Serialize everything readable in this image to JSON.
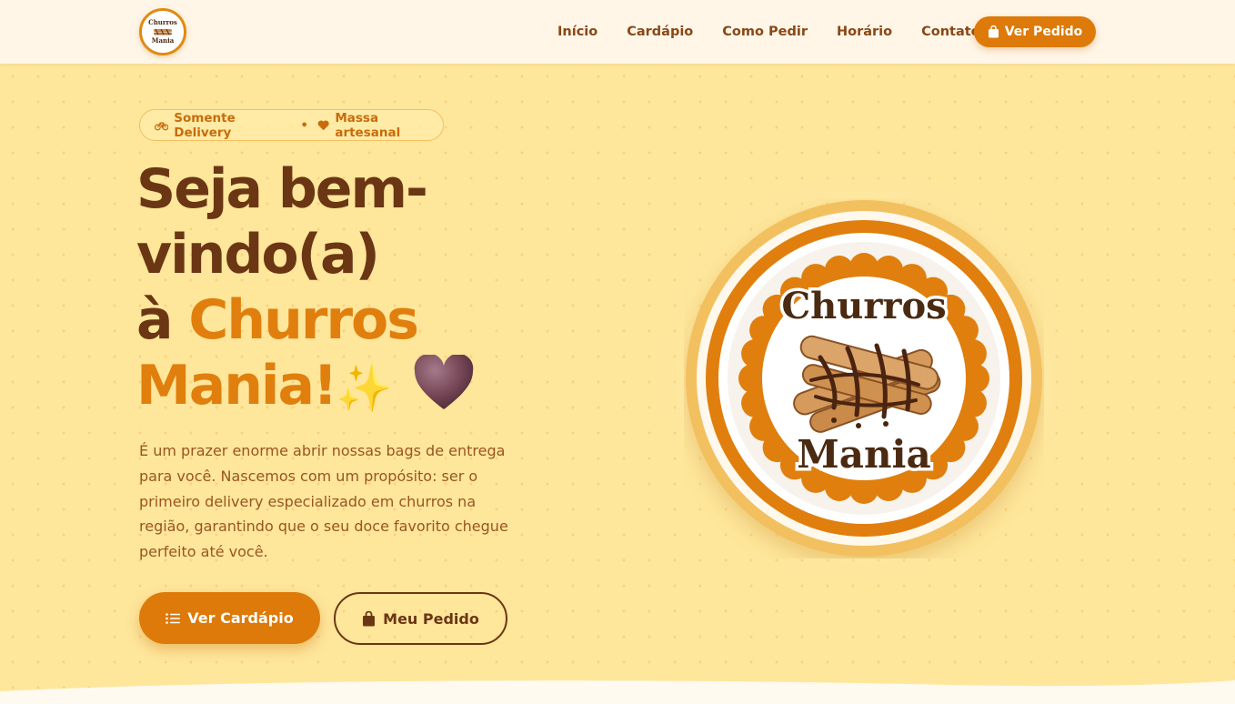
{
  "nav": {
    "logo_top": "Churros",
    "logo_bottom": "Mania",
    "links": [
      "Início",
      "Cardápio",
      "Como Pedir",
      "Horário",
      "Contato"
    ],
    "order_button": "Ver Pedido"
  },
  "hero": {
    "badge_left": "Somente Delivery",
    "badge_separator": "•",
    "badge_right": "Massa artesanal",
    "title_line1": "Seja bem-",
    "title_line2": "vindo(a)",
    "title_line3_prefix": "à ",
    "title_line3_accent": "Churros",
    "title_line4_accent": "Mania!",
    "title_sparkle": "✨",
    "description": "É um prazer enorme abrir nossas bags de entrega para você. Nascemos com um propósito: ser o primeiro delivery especializado em churros na região, garantindo que o seu doce favorito chegue perfeito até você.",
    "primary_button": "Ver Cardápio",
    "secondary_button": "Meu Pedido"
  },
  "logo": {
    "top_text": "Churros",
    "bottom_text": "Mania"
  },
  "colors": {
    "accent": "#dd7a09",
    "brown": "#6b3614",
    "background": "#fee69b",
    "nav_bg": "#fff6e8"
  },
  "icons": [
    "bike-icon",
    "heart-icon",
    "bag-icon",
    "list-icon",
    "sparkle-icon",
    "brown-heart-icon"
  ]
}
